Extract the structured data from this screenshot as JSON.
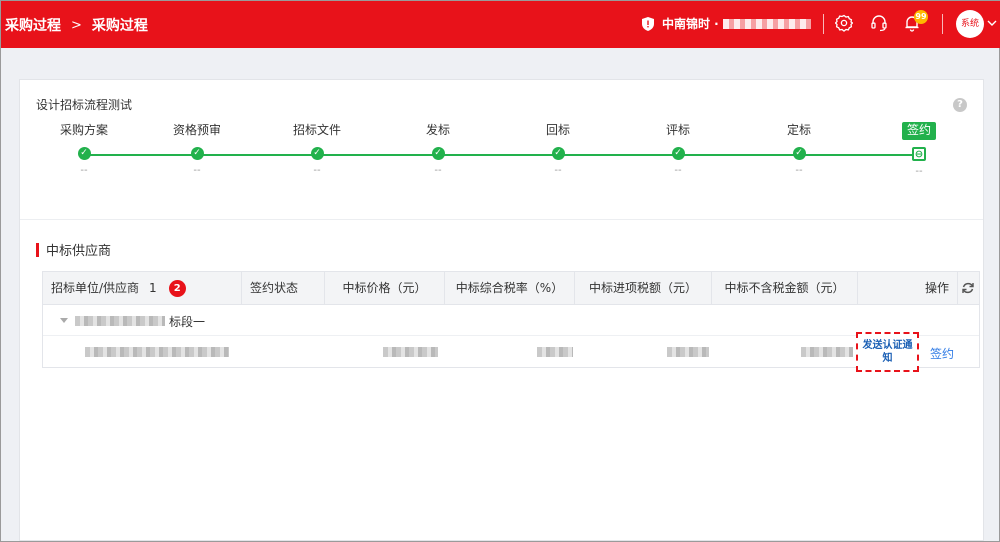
{
  "header": {
    "breadcrumb": [
      "采购过程",
      "采购过程"
    ],
    "breadcrumb_sep": ">",
    "company": "中南锦时 ·",
    "notification_count": "99",
    "avatar_label": "系统"
  },
  "process": {
    "title": "设计招标流程测试",
    "help": "?",
    "steps": [
      {
        "label": "采购方案",
        "dash": "--"
      },
      {
        "label": "资格预审",
        "dash": "--"
      },
      {
        "label": "招标文件",
        "dash": "--"
      },
      {
        "label": "发标",
        "dash": "--"
      },
      {
        "label": "回标",
        "dash": "--"
      },
      {
        "label": "评标",
        "dash": "--"
      },
      {
        "label": "定标",
        "dash": "--"
      },
      {
        "label": "签约",
        "dash": "--"
      }
    ]
  },
  "suppliers": {
    "section_title": "中标供应商",
    "columns": {
      "unit": "招标单位/供应商",
      "count": "1",
      "marker": "2",
      "status": "签约状态",
      "price": "中标价格（元）",
      "rate": "中标综合税率（%）",
      "tax": "中标进项税额（元）",
      "net": "中标不含税金额（元）",
      "action": "操作"
    },
    "group_label": "标段一",
    "row": {
      "notify_label": "发送认证通知",
      "sign_label": "签约"
    }
  },
  "colors": {
    "brand": "#e8121a",
    "progress": "#22b14c",
    "link": "#2f7be5"
  }
}
